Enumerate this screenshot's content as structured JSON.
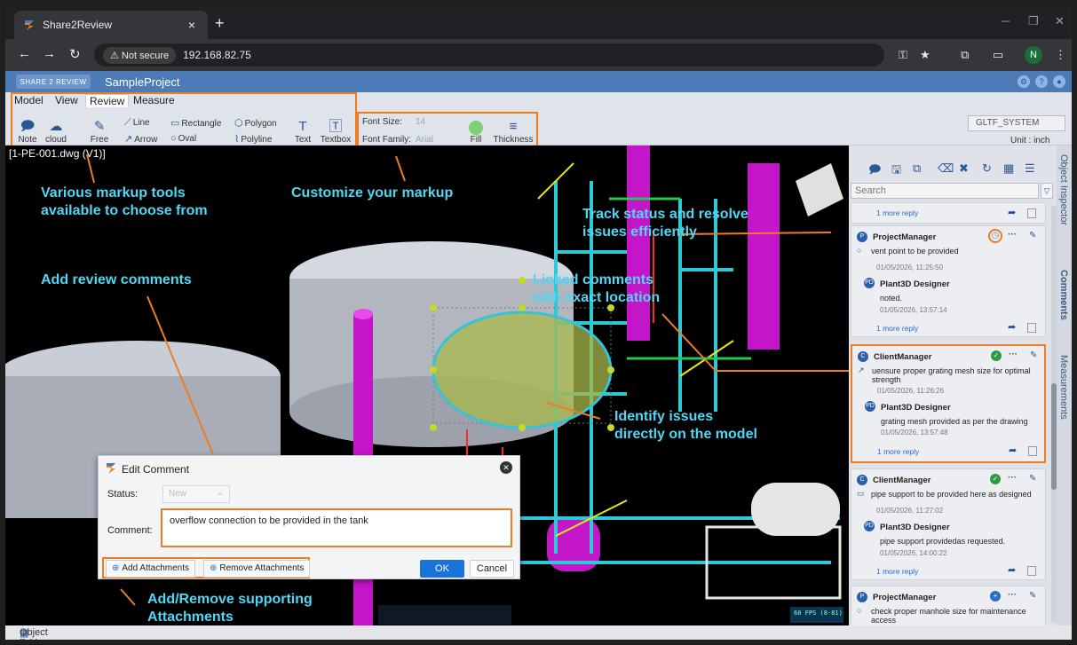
{
  "browser": {
    "tab_title": "Share2Review",
    "tab_close": "×",
    "new_tab": "+",
    "not_secure": "⚠ Not secure",
    "url": "192.168.82.75",
    "profile_initial": "N"
  },
  "app": {
    "logo_text": "SHARE 2 REVIEW",
    "project_name": "SampleProject"
  },
  "ribbon": {
    "tabs": [
      "Model",
      "View",
      "Review",
      "Measure"
    ],
    "note": "Note",
    "cloud": "cloud",
    "free": "Free",
    "line": "Line",
    "arrow": "Arrow",
    "rectangle": "Rectangle",
    "oval": "Oval",
    "polygon": "Polygon",
    "polyline": "Polyline",
    "text": "Text",
    "textbox": "Textbox",
    "font_size_label": "Font Size:",
    "font_size_value": "14",
    "font_family_label": "Font Family:",
    "font_family_value": "Arial",
    "fill": "Fill",
    "thickness": "Thickness",
    "system": "GLTF_SYSTEM",
    "unit": "Unit : inch"
  },
  "viewport": {
    "file_label": "[1-PE-001.dwg (V1)]",
    "fps": "60 FPS (8-81)",
    "annotations": {
      "markup_tools": "Various markup tools\navailable to choose from",
      "customize": "Customize your markup",
      "track": "Track status and resolve\nissues efficiently",
      "add_comments": "Add review comments",
      "linked": "Linked comments\nwith exact location",
      "identify": "Identify issues\ndirectly on the model",
      "attachments": "Add/Remove supporting\nAttachments"
    }
  },
  "dialog": {
    "title": "Edit Comment",
    "status_label": "Status:",
    "status_value": "New",
    "comment_label": "Comment:",
    "comment_value": "overflow connection to be provided in the tank",
    "add_attachments": "Add Attachments",
    "remove_attachments": "Remove Attachments",
    "ok": "OK",
    "cancel": "Cancel"
  },
  "comments_panel": {
    "search_placeholder": "Search",
    "more_reply": "1 more reply",
    "cards": [
      {
        "user": "ProjectManager",
        "avatar": "P",
        "text": "vent point to be provided",
        "time": "01/05/2026, 11:25:50",
        "reply_user": "Plant3D Designer",
        "reply_avatar": "PD",
        "reply_text": "noted.",
        "reply_time": "01/05/2026, 13:57:14"
      },
      {
        "user": "ClientManager",
        "avatar": "C",
        "text": "uensure proper grating mesh size for optimal",
        "text2": "strength",
        "time": "01/05/2026, 11:26:26",
        "reply_user": "Plant3D Designer",
        "reply_avatar": "PD",
        "reply_text": "grating mesh provided as per the drawing",
        "reply_time": "01/05/2026, 13:57:48"
      },
      {
        "user": "ClientManager",
        "avatar": "C",
        "text": "pipe support to be provided here as designed",
        "time": "01/05/2026, 11:27:02",
        "reply_user": "Plant3D Designer",
        "reply_avatar": "PD",
        "reply_text": "pipe support providedas requested.",
        "reply_time": "01/05/2026, 14:00:22"
      },
      {
        "user": "ProjectManager",
        "avatar": "P",
        "text": "check proper manhole size for maintenance",
        "text2": "access"
      }
    ]
  },
  "side_tabs": [
    "Object Inspector",
    "Comments",
    "Measurements"
  ],
  "bottom": {
    "object_table": "Object Table"
  },
  "colors": {
    "accent_orange": "#f07c22",
    "annotation_cyan": "#4fd7f3",
    "app_header": "#4d7bb7"
  }
}
